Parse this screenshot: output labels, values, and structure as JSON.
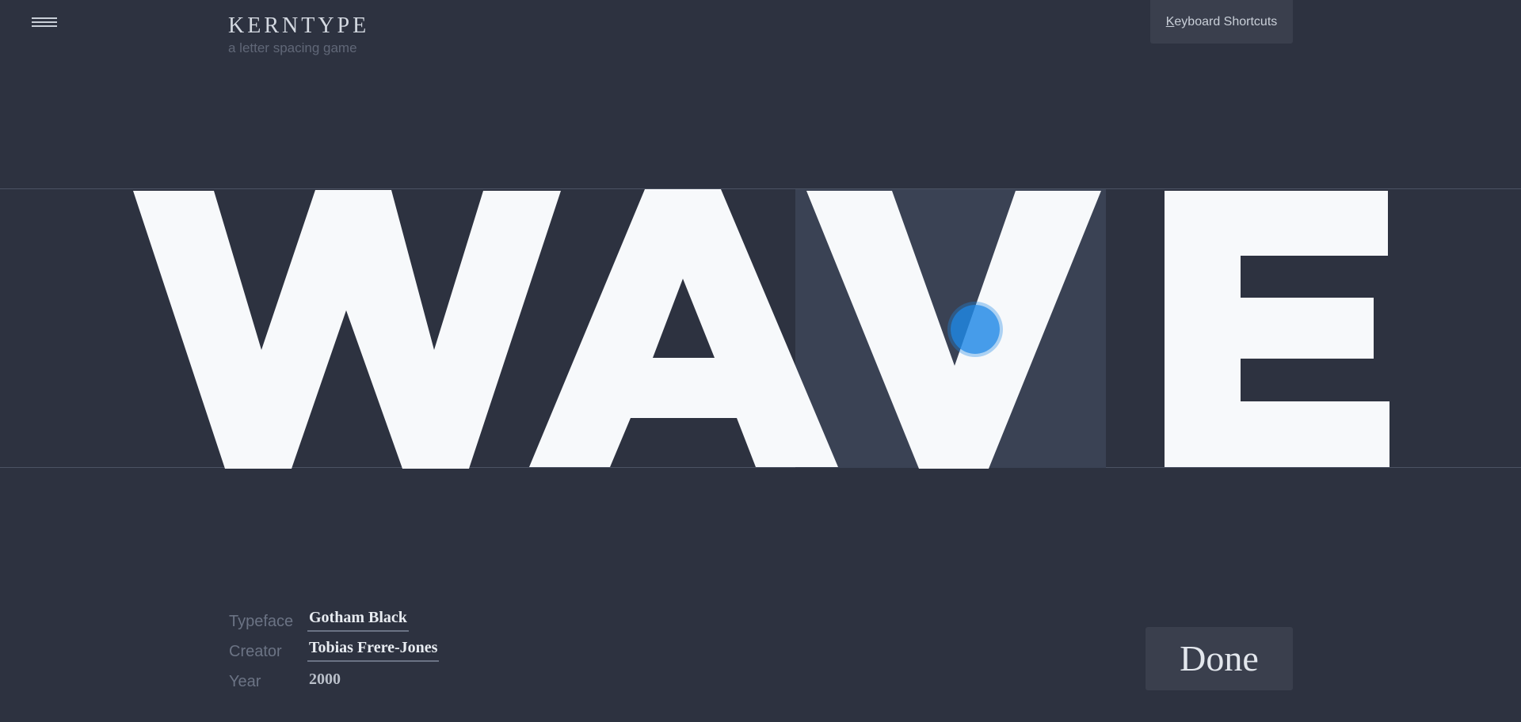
{
  "app": {
    "title": "KERNTYPE",
    "subtitle": "a letter spacing game"
  },
  "header": {
    "keyboard_shortcuts_label": "Keyboard Shortcuts",
    "keyboard_shortcuts_hotkey": "K"
  },
  "word": {
    "letters": [
      "W",
      "A",
      "V",
      "E"
    ],
    "active_letter": "V",
    "letter_color": "#f7f9fb",
    "highlight_color": "#3a4254",
    "handle_color": "#1e88e5"
  },
  "font_info": {
    "typeface_label": "Typeface",
    "typeface_value": "Gotham Black",
    "creator_label": "Creator",
    "creator_value": "Tobias Frere-Jones",
    "year_label": "Year",
    "year_value": "2000"
  },
  "actions": {
    "done_label": "Done"
  }
}
